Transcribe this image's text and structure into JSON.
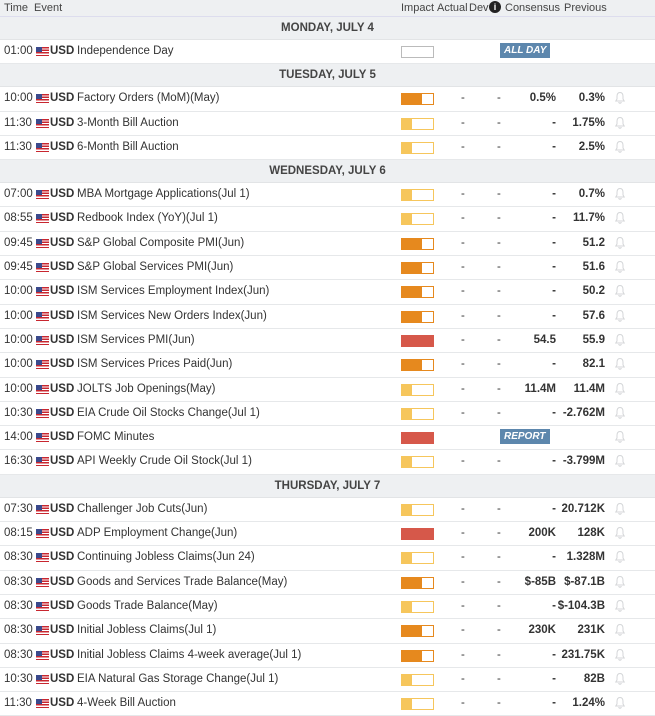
{
  "header": {
    "time": "Time",
    "event": "Event",
    "impact": "Impact",
    "actual": "Actual",
    "dev": "Dev",
    "info": "i",
    "consensus": "Consensus",
    "previous": "Previous"
  },
  "colors": {
    "low": "#f6c65c",
    "medium": "#e6891e",
    "high": "#d6584a"
  },
  "days": [
    {
      "label": "MONDAY, JULY 4",
      "events": [
        {
          "time": "01:00",
          "currency": "USD",
          "event": "Independence Day",
          "impact": "none",
          "badge": "ALL DAY",
          "bell": false
        }
      ]
    },
    {
      "label": "TUESDAY, JULY 5",
      "events": [
        {
          "time": "10:00",
          "currency": "USD",
          "event": "Factory Orders (MoM)(May)",
          "impact": "medium",
          "actual": "-",
          "dev": "-",
          "consensus": "0.5%",
          "previous": "0.3%"
        },
        {
          "time": "11:30",
          "currency": "USD",
          "event": "3-Month Bill Auction",
          "impact": "low",
          "actual": "-",
          "dev": "-",
          "consensus": "-",
          "previous": "1.75%"
        },
        {
          "time": "11:30",
          "currency": "USD",
          "event": "6-Month Bill Auction",
          "impact": "low",
          "actual": "-",
          "dev": "-",
          "consensus": "-",
          "previous": "2.5%"
        }
      ]
    },
    {
      "label": "WEDNESDAY, JULY 6",
      "events": [
        {
          "time": "07:00",
          "currency": "USD",
          "event": "MBA Mortgage Applications(Jul 1)",
          "impact": "low",
          "actual": "-",
          "dev": "-",
          "consensus": "-",
          "previous": "0.7%"
        },
        {
          "time": "08:55",
          "currency": "USD",
          "event": "Redbook Index (YoY)(Jul 1)",
          "impact": "low",
          "actual": "-",
          "dev": "-",
          "consensus": "-",
          "previous": "11.7%"
        },
        {
          "time": "09:45",
          "currency": "USD",
          "event": "S&P Global Composite PMI(Jun)",
          "impact": "medium",
          "actual": "-",
          "dev": "-",
          "consensus": "-",
          "previous": "51.2"
        },
        {
          "time": "09:45",
          "currency": "USD",
          "event": "S&P Global Services PMI(Jun)",
          "impact": "medium",
          "actual": "-",
          "dev": "-",
          "consensus": "-",
          "previous": "51.6"
        },
        {
          "time": "10:00",
          "currency": "USD",
          "event": "ISM Services Employment Index(Jun)",
          "impact": "medium",
          "actual": "-",
          "dev": "-",
          "consensus": "-",
          "previous": "50.2"
        },
        {
          "time": "10:00",
          "currency": "USD",
          "event": "ISM Services New Orders Index(Jun)",
          "impact": "medium",
          "actual": "-",
          "dev": "-",
          "consensus": "-",
          "previous": "57.6"
        },
        {
          "time": "10:00",
          "currency": "USD",
          "event": "ISM Services PMI(Jun)",
          "impact": "high",
          "actual": "-",
          "dev": "-",
          "consensus": "54.5",
          "previous": "55.9"
        },
        {
          "time": "10:00",
          "currency": "USD",
          "event": "ISM Services Prices Paid(Jun)",
          "impact": "medium",
          "actual": "-",
          "dev": "-",
          "consensus": "-",
          "previous": "82.1"
        },
        {
          "time": "10:00",
          "currency": "USD",
          "event": "JOLTS Job Openings(May)",
          "impact": "low",
          "actual": "-",
          "dev": "-",
          "consensus": "11.4M",
          "previous": "11.4M"
        },
        {
          "time": "10:30",
          "currency": "USD",
          "event": "EIA Crude Oil Stocks Change(Jul 1)",
          "impact": "low",
          "actual": "-",
          "dev": "-",
          "consensus": "-",
          "previous": "-2.762M"
        },
        {
          "time": "14:00",
          "currency": "USD",
          "event": "FOMC Minutes",
          "impact": "high",
          "badge": "REPORT"
        },
        {
          "time": "16:30",
          "currency": "USD",
          "event": "API Weekly Crude Oil Stock(Jul 1)",
          "impact": "low",
          "actual": "-",
          "dev": "-",
          "consensus": "-",
          "previous": "-3.799M"
        }
      ]
    },
    {
      "label": "THURSDAY, JULY 7",
      "events": [
        {
          "time": "07:30",
          "currency": "USD",
          "event": "Challenger Job Cuts(Jun)",
          "impact": "low",
          "actual": "-",
          "dev": "-",
          "consensus": "-",
          "previous": "20.712K"
        },
        {
          "time": "08:15",
          "currency": "USD",
          "event": "ADP Employment Change(Jun)",
          "impact": "high",
          "actual": "-",
          "dev": "-",
          "consensus": "200K",
          "previous": "128K"
        },
        {
          "time": "08:30",
          "currency": "USD",
          "event": "Continuing Jobless Claims(Jun 24)",
          "impact": "low",
          "actual": "-",
          "dev": "-",
          "consensus": "-",
          "previous": "1.328M"
        },
        {
          "time": "08:30",
          "currency": "USD",
          "event": "Goods and Services Trade Balance(May)",
          "impact": "medium",
          "actual": "-",
          "dev": "-",
          "consensus": "$-85B",
          "previous": "$-87.1B"
        },
        {
          "time": "08:30",
          "currency": "USD",
          "event": "Goods Trade Balance(May)",
          "impact": "low",
          "actual": "-",
          "dev": "-",
          "consensus": "-",
          "previous": "$-104.3B"
        },
        {
          "time": "08:30",
          "currency": "USD",
          "event": "Initial Jobless Claims(Jul 1)",
          "impact": "medium",
          "actual": "-",
          "dev": "-",
          "consensus": "230K",
          "previous": "231K"
        },
        {
          "time": "08:30",
          "currency": "USD",
          "event": "Initial Jobless Claims 4-week average(Jul 1)",
          "impact": "medium",
          "actual": "-",
          "dev": "-",
          "consensus": "-",
          "previous": "231.75K"
        },
        {
          "time": "10:30",
          "currency": "USD",
          "event": "EIA Natural Gas Storage Change(Jul 1)",
          "impact": "low",
          "actual": "-",
          "dev": "-",
          "consensus": "-",
          "previous": "82B"
        },
        {
          "time": "11:30",
          "currency": "USD",
          "event": "4-Week Bill Auction",
          "impact": "low",
          "actual": "-",
          "dev": "-",
          "consensus": "-",
          "previous": "1.24%"
        }
      ]
    }
  ]
}
